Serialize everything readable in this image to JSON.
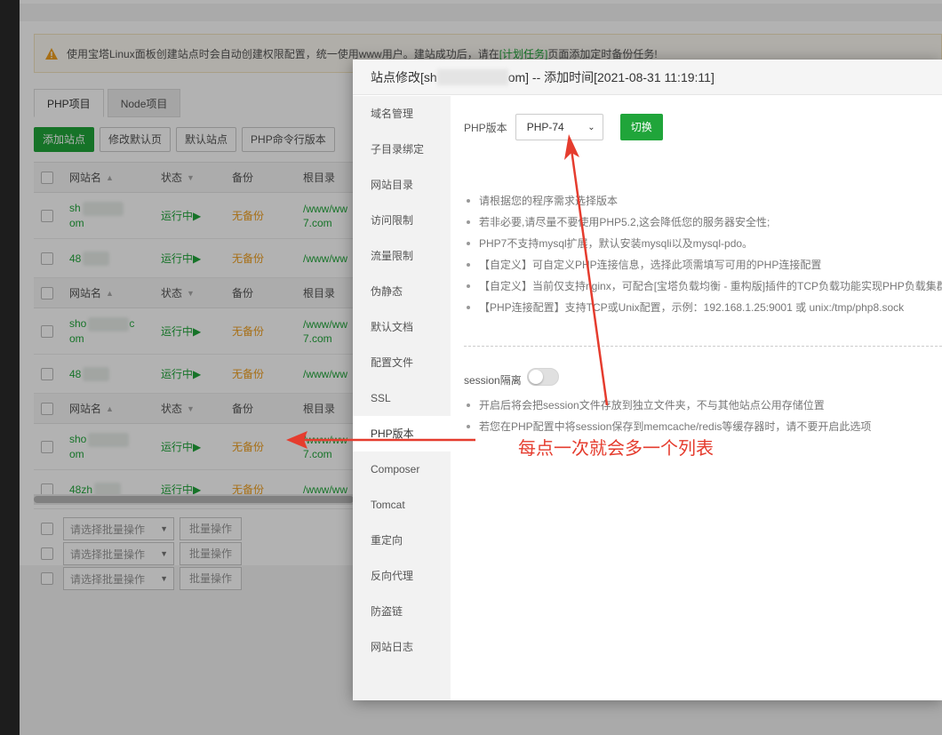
{
  "notice": {
    "text_before": "使用宝塔Linux面板创建站点时会自动创建权限配置，统一使用www用户。建站成功后，请在",
    "link": "[计划任务]",
    "text_after": "页面添加定时备份任务!"
  },
  "tabs": [
    "PHP项目",
    "Node项目"
  ],
  "toolbar": [
    "添加站点",
    "修改默认页",
    "默认站点",
    "PHP命令行版本"
  ],
  "table_headers": {
    "name": "网站名",
    "status": "状态",
    "backup": "备份",
    "root": "根目录"
  },
  "rows": [
    {
      "name1": "sh",
      "name2": "om",
      "status": "运行中▶",
      "backup": "无备份",
      "root1": "/www/ww",
      "root2": "7.com"
    },
    {
      "name1": "48",
      "status": "运行中▶",
      "backup": "无备份",
      "root1": "/www/ww"
    },
    {
      "name1": "sho",
      "name1b": "c",
      "name2": "om",
      "status": "运行中▶",
      "backup": "无备份",
      "root1": "/www/ww",
      "root2": "7.com"
    },
    {
      "name1": "48",
      "status": "运行中▶",
      "backup": "无备份",
      "root1": "/www/ww"
    },
    {
      "name1": "sho",
      "name2": "om",
      "status": "运行中▶",
      "backup": "无备份",
      "root1": "/www/ww",
      "root2": "7.com"
    },
    {
      "name1": "48zh",
      "status": "运行中▶",
      "backup": "无备份",
      "root1": "/www/ww"
    }
  ],
  "batch": {
    "select_placeholder": "请选择批量操作",
    "button": "批量操作"
  },
  "modal": {
    "title_prefix": "站点修改[sh",
    "title_suffix": "om] -- 添加时间[2021-08-31 11:19:11]",
    "menu": [
      "域名管理",
      "子目录绑定",
      "网站目录",
      "访问限制",
      "流量限制",
      "伪静态",
      "默认文档",
      "配置文件",
      "SSL",
      "PHP版本",
      "Composer",
      "Tomcat",
      "重定向",
      "反向代理",
      "防盗链",
      "网站日志"
    ],
    "active_menu": "PHP版本",
    "php_label": "PHP版本",
    "php_value": "PHP-74",
    "switch_button": "切换",
    "tips": [
      "请根据您的程序需求选择版本",
      "若非必要,请尽量不要使用PHP5.2,这会降低您的服务器安全性;",
      "PHP7不支持mysql扩展，默认安装mysqli以及mysql-pdo。",
      "【自定义】可自定义PHP连接信息，选择此项需填写可用的PHP连接配置",
      "【自定义】当前仅支持nginx，可配合[宝塔负载均衡 - 重构版]插件的TCP负载功能实现PHP负载集群",
      "【PHP连接配置】支持TCP或Unix配置，示例：192.168.1.25:9001 或 unix:/tmp/php8.sock"
    ],
    "session_label": "session隔离",
    "session_tips": [
      "开启后将会把session文件存放到独立文件夹，不与其他站点公用存储位置",
      "若您在PHP配置中将session保存到memcache/redis等缓存器时，请不要开启此选项"
    ]
  },
  "annotation": "每点一次就会多一个列表",
  "colors": {
    "accent": "#20a53a",
    "warning": "#f0a020",
    "annotation": "#e53c2e"
  }
}
